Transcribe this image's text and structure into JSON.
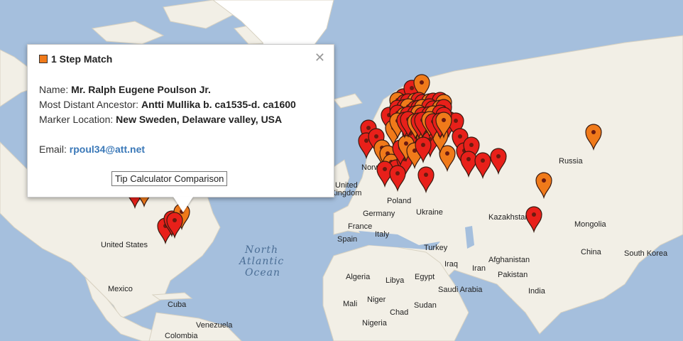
{
  "popup": {
    "title": "1 Step Match",
    "close_icon": "close-icon",
    "name_label": "Name:",
    "name_value": "Mr. Ralph Eugene Poulson Jr.",
    "ancestor_label": "Most Distant Ancestor:",
    "ancestor_value": "Antti Mullika b. ca1535-d. ca1600",
    "location_label": "Marker Location:",
    "location_value": "New Sweden, Delaware valley, USA",
    "email_label": "Email:",
    "email_value": "rpoul34@att.net",
    "button_label": "Tip Calculator Comparison",
    "square_color": "#f07a1a"
  },
  "map": {
    "ocean_label_1": "North",
    "ocean_label_2": "Atlantic",
    "ocean_label_3": "Ocean",
    "labels": {
      "united_states": "United States",
      "mexico": "Mexico",
      "cuba": "Cuba",
      "venezuela": "Venezuela",
      "colombia": "Colombia",
      "united_kingdom_1": "United",
      "united_kingdom_2": "Kingdom",
      "norway": "Norw",
      "germany": "Germany",
      "poland": "Poland",
      "ukraine": "Ukraine",
      "france": "France",
      "spain": "Spain",
      "italy": "Italy",
      "turkey": "Turkey",
      "iraq": "Iraq",
      "iran": "Iran",
      "afghanistan": "Afghanistan",
      "pakistan": "Pakistan",
      "india": "India",
      "kazakhstan": "Kazakhstan",
      "mongolia": "Mongolia",
      "china": "China",
      "south_korea": "South Korea",
      "russia": "Russia",
      "algeria": "Algeria",
      "libya": "Libya",
      "egypt": "Egypt",
      "saudi_arabia": "Saudi Arabia",
      "mali": "Mali",
      "niger": "Niger",
      "chad": "Chad",
      "sudan": "Sudan",
      "nigeria": "Nigeria"
    },
    "colors": {
      "water": "#a5bfdd",
      "land": "#f2efe6",
      "greenland": "#ffffff",
      "marker_red": "#e8201a",
      "marker_orange": "#f07a1a"
    }
  }
}
